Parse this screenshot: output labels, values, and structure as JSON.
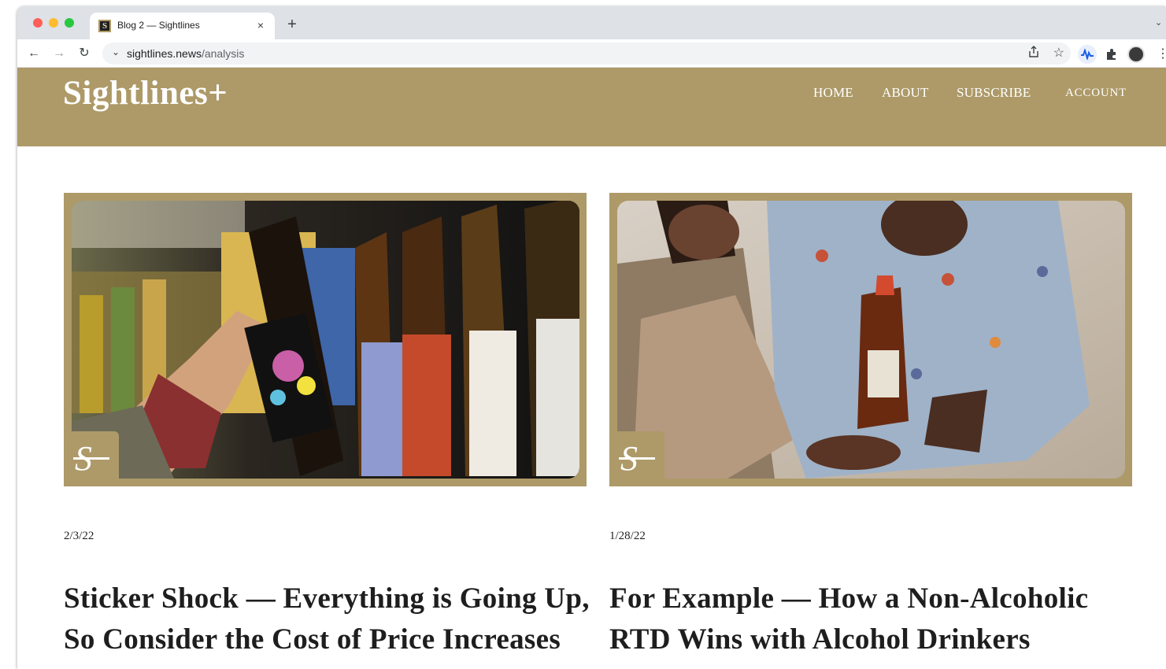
{
  "browser": {
    "tab": {
      "title": "Blog 2 — Sightlines",
      "favicon": "S",
      "close": "×"
    },
    "new_tab": "+",
    "tabs_dropdown": "⌄",
    "nav": {
      "back": "←",
      "forward": "→",
      "reload": "↻"
    },
    "omnibox": {
      "icon": "⌄",
      "host": "sightlines.news",
      "path": "/analysis"
    },
    "icons": [
      "share-icon",
      "star-icon",
      "extension-wave-icon",
      "puzzle-icon",
      "profile-avatar",
      "menu-icon"
    ]
  },
  "site": {
    "logo": "Sightlines+",
    "nav": {
      "home": "HOME",
      "about": "ABOUT",
      "subscribe": "SUBSCRIBE",
      "account": "ACCOUNT"
    },
    "colors": {
      "brand": "#ad9a68",
      "text": "#1e1e1e"
    }
  },
  "posts": [
    {
      "date": "2/3/22",
      "title": "Sticker Shock — Everything is Going Up, So Consider the Cost of Price Increases",
      "badge": "S"
    },
    {
      "date": "1/28/22",
      "title": "For Example — How a Non-Alcoholic RTD Wins with Alcohol Drinkers",
      "badge": "S"
    }
  ]
}
